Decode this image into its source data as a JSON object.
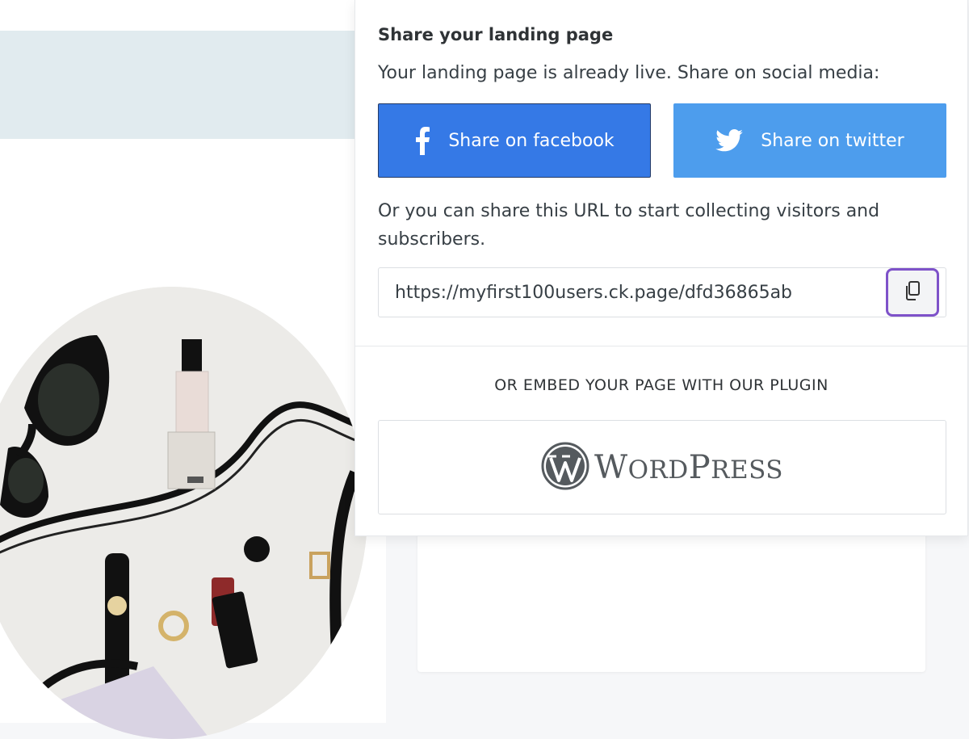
{
  "share_panel": {
    "title": "Share your landing page",
    "subtitle": "Your landing page is already live. Share on social media:",
    "facebook_button": {
      "label": "Share on facebook",
      "icon": "facebook-icon",
      "color": "#3579e6"
    },
    "twitter_button": {
      "label": "Share on twitter",
      "icon": "twitter-icon",
      "color": "#4d9ded"
    },
    "url_instructions": "Or you can share this URL to start collecting visitors and subscribers.",
    "url_value": "https://myfirst100users.ck.page/dfd36865ab",
    "copy_button": {
      "icon": "copy-icon",
      "focus_color": "#7e52c9"
    },
    "embed_label": "OR EMBED YOUR PAGE WITH OUR PLUGIN",
    "wordpress": {
      "icon": "wordpress-logo-icon",
      "wordmark": {
        "w": "W",
        "ord": "ORD",
        "p": "P",
        "ress": "RESS"
      }
    }
  },
  "background": {
    "band_color": "#e1ebef",
    "photo_description_icon": "product-photo-circle"
  }
}
